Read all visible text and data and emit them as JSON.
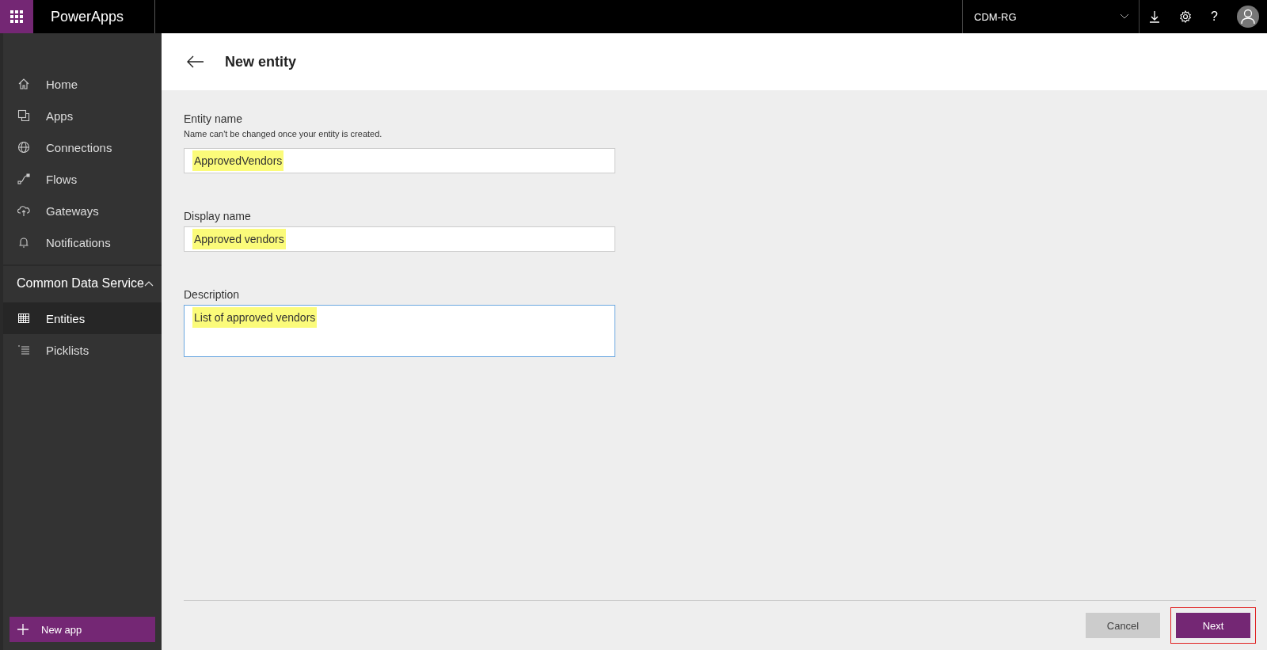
{
  "topbar": {
    "app_name": "PowerApps",
    "environment": "CDM-RG",
    "help": "?"
  },
  "sidebar": {
    "items": [
      {
        "label": "Home",
        "kind": "home",
        "selected": false
      },
      {
        "label": "Apps",
        "kind": "apps",
        "selected": false
      },
      {
        "label": "Connections",
        "kind": "globe",
        "selected": false
      },
      {
        "label": "Flows",
        "kind": "flow",
        "selected": false
      },
      {
        "label": "Gateways",
        "kind": "cloud",
        "selected": false
      },
      {
        "label": "Notifications",
        "kind": "bell",
        "selected": false
      }
    ],
    "section": {
      "label": "Common Data Service",
      "expanded": true,
      "items": [
        {
          "label": "Entities",
          "kind": "table",
          "selected": true
        },
        {
          "label": "Picklists",
          "kind": "list",
          "selected": false
        }
      ]
    },
    "new_app_button": "New app"
  },
  "page": {
    "title": "New entity"
  },
  "form": {
    "fields": [
      {
        "kind": "input",
        "label": "Entity name",
        "hint": "Name can't be changed once your entity is created.",
        "value": "ApprovedVendors",
        "highlighted": true,
        "focused": false
      },
      {
        "kind": "input",
        "label": "Display name",
        "value": "Approved vendors",
        "highlighted": true,
        "focused": false
      },
      {
        "kind": "textarea",
        "label": "Description",
        "value": "List of approved vendors",
        "highlighted": true,
        "focused": true
      }
    ]
  },
  "footer": {
    "buttons": [
      {
        "label": "Cancel",
        "kind": "secondary",
        "outlined": false
      },
      {
        "label": "Next",
        "kind": "primary",
        "outlined": true
      }
    ]
  }
}
